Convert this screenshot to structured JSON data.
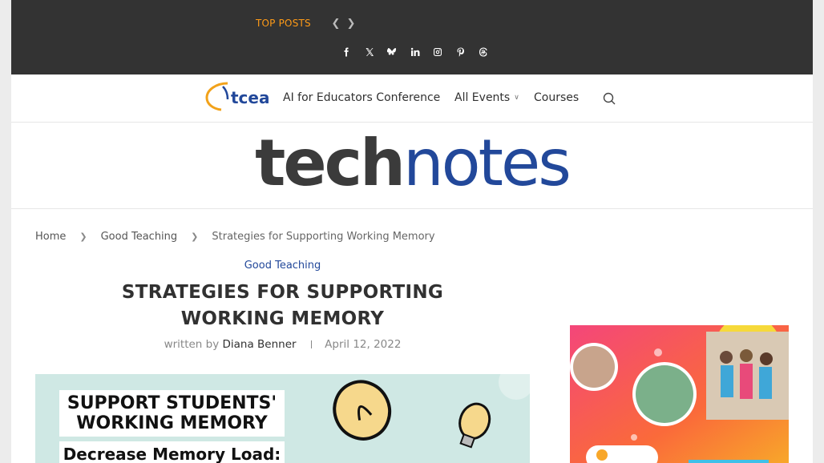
{
  "topbar": {
    "top_posts_label": "TOP POSTS",
    "prev_icon": "chevron-left-icon",
    "next_icon": "chevron-right-icon",
    "social": [
      "facebook-icon",
      "x-icon",
      "bluesky-icon",
      "linkedin-icon",
      "instagram-icon",
      "pinterest-icon",
      "threads-icon"
    ]
  },
  "nav": {
    "logo_text": "tcea",
    "items": [
      {
        "label": "AI for Educators Conference"
      },
      {
        "label": "All Events"
      },
      {
        "label": "Courses"
      }
    ],
    "search_icon": "search-icon"
  },
  "masthead": {
    "brand_part1": "tech",
    "brand_part2": "notes"
  },
  "breadcrumb": {
    "home": "Home",
    "category": "Good Teaching",
    "current": "Strategies for Supporting Working Memory"
  },
  "article": {
    "category": "Good Teaching",
    "title": "STRATEGIES FOR SUPPORTING WORKING MEMORY",
    "written_by": "written by",
    "author": "Diana Benner",
    "date": "April 12, 2022",
    "hero_heading": "SUPPORT STUDENTS' WORKING MEMORY",
    "hero_subheading": "Decrease Memory Load:"
  },
  "colors": {
    "topbar_bg": "#333333",
    "accent_orange": "#ff9b17",
    "brand_blue": "#22489a",
    "text_dark": "#313131"
  }
}
